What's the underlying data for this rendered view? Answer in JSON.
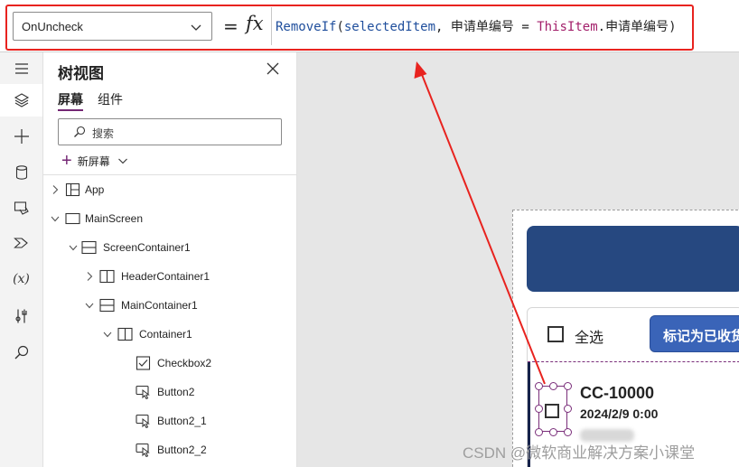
{
  "formula_bar": {
    "property": "OnUncheck",
    "equals": "=",
    "fx": "fx",
    "formula": {
      "fn": "RemoveIf",
      "open": "(",
      "arg1": "selectedItem",
      "comma": ", ",
      "field": "申请单编号",
      "op": " = ",
      "kw": "ThisItem",
      "dot": ".",
      "field2": "申请单编号",
      "close": ")"
    }
  },
  "rail": {
    "items": [
      "menu-icon",
      "layers-icon",
      "plus-icon",
      "data-icon",
      "media-icon",
      "power-automate-icon",
      "variables-icon",
      "tools-icon",
      "search-icon"
    ],
    "variables_label": "(x)"
  },
  "tree": {
    "title": "树视图",
    "tabs": [
      {
        "label": "屏幕",
        "active": true
      },
      {
        "label": "组件",
        "active": false
      }
    ],
    "search_placeholder": "搜索",
    "new_screen_label": "新屏幕",
    "nodes": [
      {
        "name": "App",
        "indent": 0,
        "expanded": false,
        "icon": "app-icon"
      },
      {
        "name": "MainScreen",
        "indent": 0,
        "expanded": true,
        "icon": "screen-icon"
      },
      {
        "name": "ScreenContainer1",
        "indent": 1,
        "expanded": true,
        "icon": "vertical-container-icon"
      },
      {
        "name": "HeaderContainer1",
        "indent": 2,
        "expanded": false,
        "icon": "horizontal-container-icon"
      },
      {
        "name": "MainContainer1",
        "indent": 2,
        "expanded": true,
        "icon": "vertical-container-icon"
      },
      {
        "name": "Container1",
        "indent": 3,
        "expanded": true,
        "icon": "horizontal-container-icon"
      },
      {
        "name": "Checkbox2",
        "indent": 4,
        "expanded": null,
        "icon": "checkbox-icon"
      },
      {
        "name": "Button2",
        "indent": 4,
        "expanded": null,
        "icon": "button-icon"
      },
      {
        "name": "Button2_1",
        "indent": 4,
        "expanded": null,
        "icon": "button-icon"
      },
      {
        "name": "Button2_2",
        "indent": 4,
        "expanded": null,
        "icon": "button-icon"
      }
    ]
  },
  "canvas": {
    "select_all_label": "全选",
    "mark_button_label": "标记为已收货",
    "item": {
      "title": "CC-10000",
      "date": "2024/2/9 0:00"
    }
  },
  "watermark": "CSDN @微软商业解决方案小课堂",
  "colors": {
    "accent": "#742774",
    "header": "#264880",
    "button": "#3a64b8",
    "annotation": "#e8231f"
  }
}
